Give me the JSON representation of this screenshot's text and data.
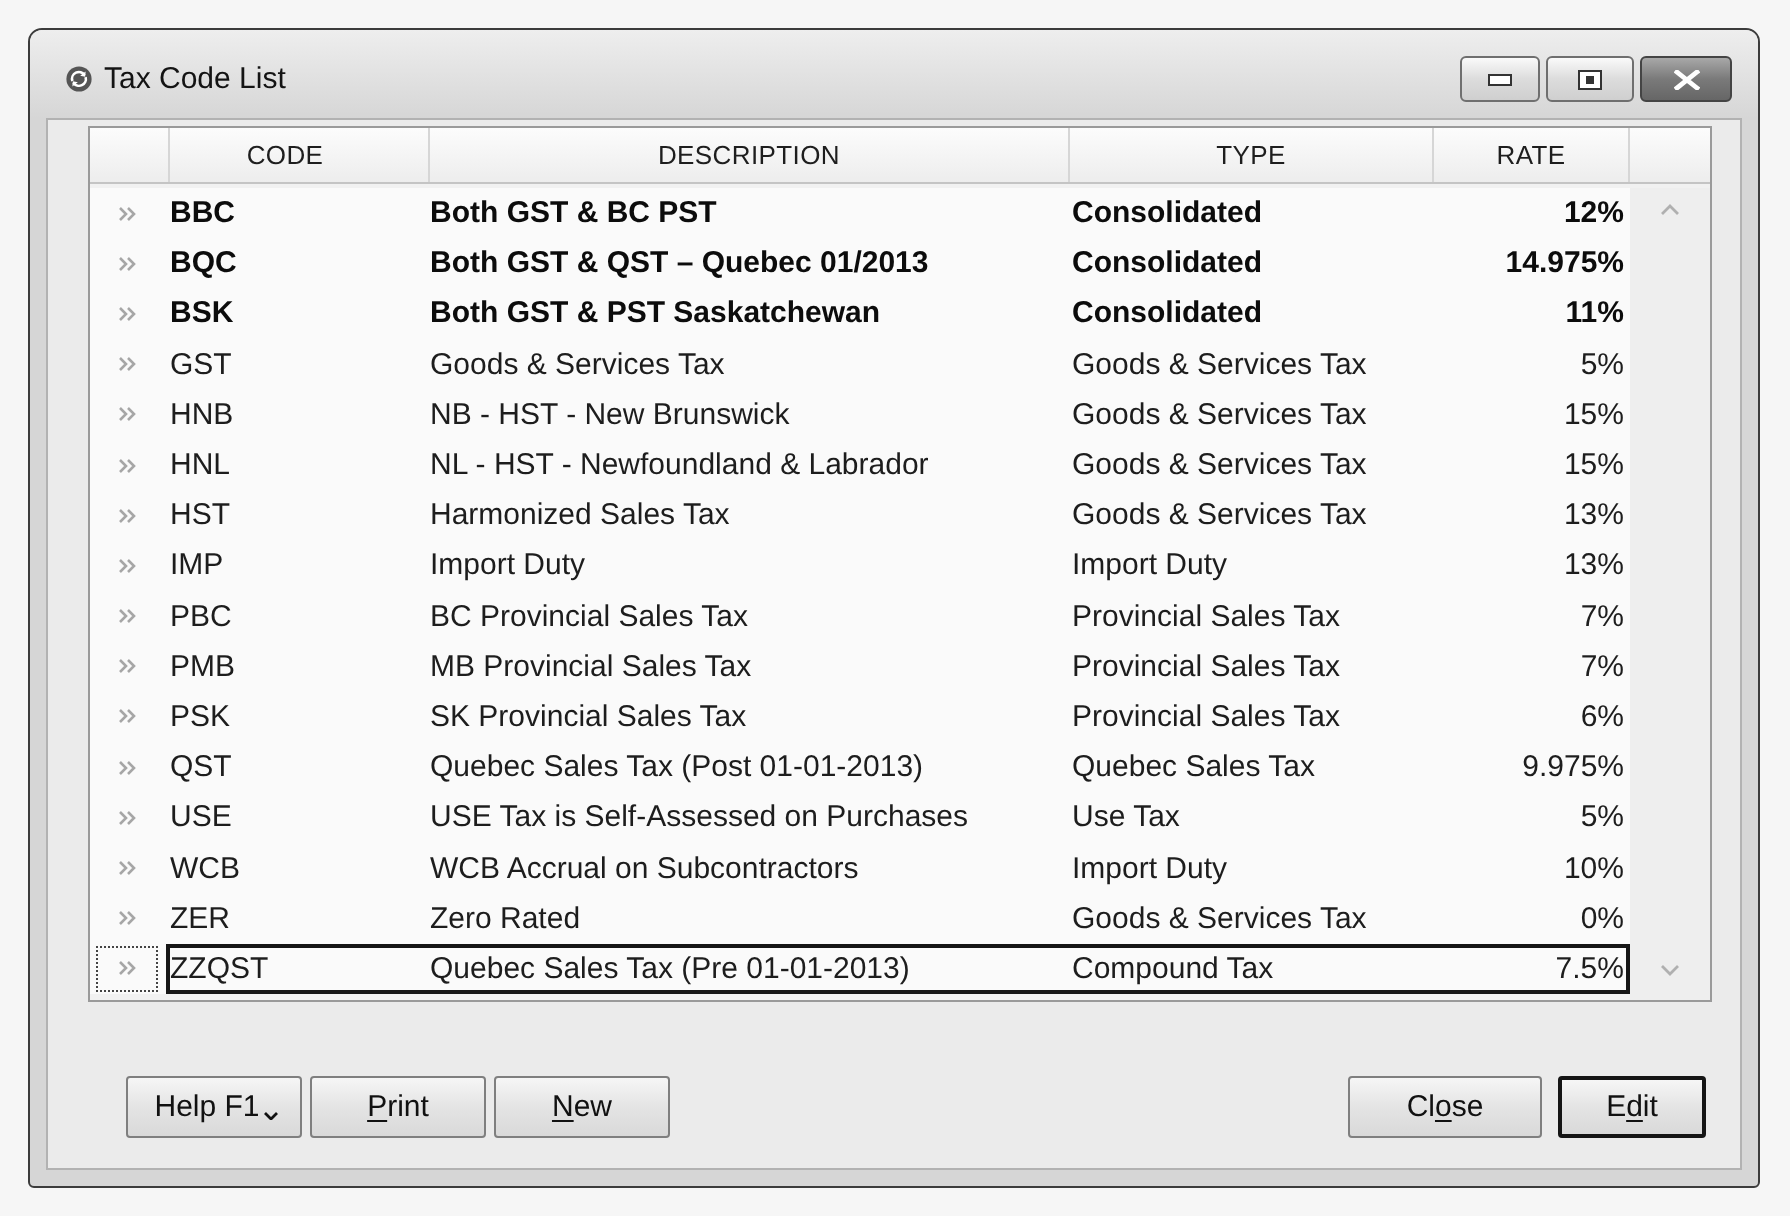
{
  "window": {
    "title": "Tax Code List"
  },
  "table": {
    "columns": [
      "CODE",
      "DESCRIPTION",
      "TYPE",
      "RATE"
    ],
    "rows": [
      {
        "code": "BBC",
        "description": "Both GST & BC PST",
        "type": "Consolidated",
        "rate": "12%",
        "bold": true,
        "selected": false
      },
      {
        "code": "BQC",
        "description": "Both GST & QST – Quebec 01/2013",
        "type": "Consolidated",
        "rate": "14.975%",
        "bold": true,
        "selected": false
      },
      {
        "code": "BSK",
        "description": "Both GST & PST Saskatchewan",
        "type": "Consolidated",
        "rate": "11%",
        "bold": true,
        "selected": false
      },
      {
        "code": "GST",
        "description": "Goods & Services Tax",
        "type": "Goods & Services Tax",
        "rate": "5%",
        "bold": false,
        "selected": false
      },
      {
        "code": "HNB",
        "description": "NB - HST - New Brunswick",
        "type": "Goods & Services Tax",
        "rate": "15%",
        "bold": false,
        "selected": false
      },
      {
        "code": "HNL",
        "description": "NL - HST - Newfoundland & Labrador",
        "type": "Goods & Services Tax",
        "rate": "15%",
        "bold": false,
        "selected": false
      },
      {
        "code": "HST",
        "description": "Harmonized Sales Tax",
        "type": "Goods & Services Tax",
        "rate": "13%",
        "bold": false,
        "selected": false
      },
      {
        "code": "IMP",
        "description": "Import Duty",
        "type": "Import Duty",
        "rate": "13%",
        "bold": false,
        "selected": false
      },
      {
        "code": "PBC",
        "description": "BC Provincial Sales Tax",
        "type": "Provincial Sales Tax",
        "rate": "7%",
        "bold": false,
        "selected": false
      },
      {
        "code": "PMB",
        "description": "MB Provincial Sales Tax",
        "type": "Provincial Sales Tax",
        "rate": "7%",
        "bold": false,
        "selected": false
      },
      {
        "code": "PSK",
        "description": "SK Provincial Sales Tax",
        "type": "Provincial Sales Tax",
        "rate": "6%",
        "bold": false,
        "selected": false
      },
      {
        "code": "QST",
        "description": "Quebec Sales Tax (Post 01-01-2013)",
        "type": "Quebec Sales Tax",
        "rate": "9.975%",
        "bold": false,
        "selected": false
      },
      {
        "code": "USE",
        "description": "USE Tax is Self-Assessed on Purchases",
        "type": "Use Tax",
        "rate": "5%",
        "bold": false,
        "selected": false
      },
      {
        "code": "WCB",
        "description": "WCB Accrual on Subcontractors",
        "type": "Import Duty",
        "rate": "10%",
        "bold": false,
        "selected": false
      },
      {
        "code": "ZER",
        "description": "Zero Rated",
        "type": "Goods & Services Tax",
        "rate": "0%",
        "bold": false,
        "selected": false
      },
      {
        "code": "ZZQST",
        "description": "Quebec Sales Tax (Pre 01-01-2013)",
        "type": "Compound Tax",
        "rate": "7.5%",
        "bold": false,
        "selected": true
      }
    ]
  },
  "footer": {
    "left_buttons": [
      {
        "kind": "menu",
        "label_parts": [
          {
            "text": "Help F1",
            "underlined": false
          }
        ],
        "default": false
      },
      {
        "kind": "push",
        "label_parts": [
          {
            "text": "P",
            "underlined": true
          },
          {
            "text": "rint",
            "underlined": false
          }
        ],
        "default": false
      },
      {
        "kind": "push",
        "label_parts": [
          {
            "text": "N",
            "underlined": true
          },
          {
            "text": "ew",
            "underlined": false
          }
        ],
        "default": false
      }
    ],
    "right_buttons": [
      {
        "kind": "push",
        "label_parts": [
          {
            "text": "Cl",
            "underlined": false
          },
          {
            "text": "o",
            "underlined": true
          },
          {
            "text": "se",
            "underlined": false
          }
        ],
        "default": false
      },
      {
        "kind": "push",
        "label_parts": [
          {
            "text": "E",
            "underlined": false
          },
          {
            "text": "d",
            "underlined": true
          },
          {
            "text": "it",
            "underlined": false
          }
        ],
        "default": true
      }
    ]
  }
}
